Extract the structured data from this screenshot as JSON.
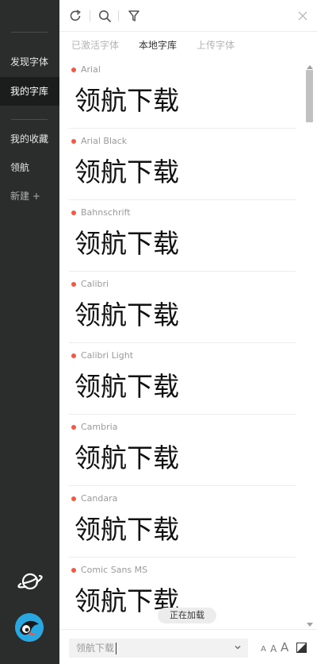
{
  "sidebar": {
    "items": [
      {
        "label": "发现字体"
      },
      {
        "label": "我的字库"
      },
      {
        "label": "我的收藏"
      },
      {
        "label": "领航"
      },
      {
        "label": "新建 +"
      }
    ]
  },
  "toolbar": {
    "icons": [
      "refresh-icon",
      "search-icon",
      "filter-icon",
      "close-icon"
    ]
  },
  "tabs": [
    {
      "label": "已激活字体"
    },
    {
      "label": "本地字库"
    },
    {
      "label": "上传字体"
    }
  ],
  "fonts": [
    {
      "name": "Arial",
      "preview": "领航下载"
    },
    {
      "name": "Arial Black",
      "preview": "领航下载"
    },
    {
      "name": "Bahnschrift",
      "preview": "领航下载"
    },
    {
      "name": "Calibri",
      "preview": "领航下载"
    },
    {
      "name": "Calibri Light",
      "preview": "领航下载"
    },
    {
      "name": "Cambria",
      "preview": "领航下载"
    },
    {
      "name": "Candara",
      "preview": "领航下载"
    },
    {
      "name": "Comic Sans MS",
      "preview": "领航下载"
    }
  ],
  "loading_text": "正在加载",
  "bottom": {
    "preview_text": "领航下载",
    "size_labels": [
      "A",
      "A",
      "A"
    ]
  },
  "colors": {
    "sidebar_bg": "#2b2d2c",
    "sidebar_active": "#1b1c1c",
    "status_dot": "#f05a45",
    "avatar": "#2aa7e0"
  }
}
